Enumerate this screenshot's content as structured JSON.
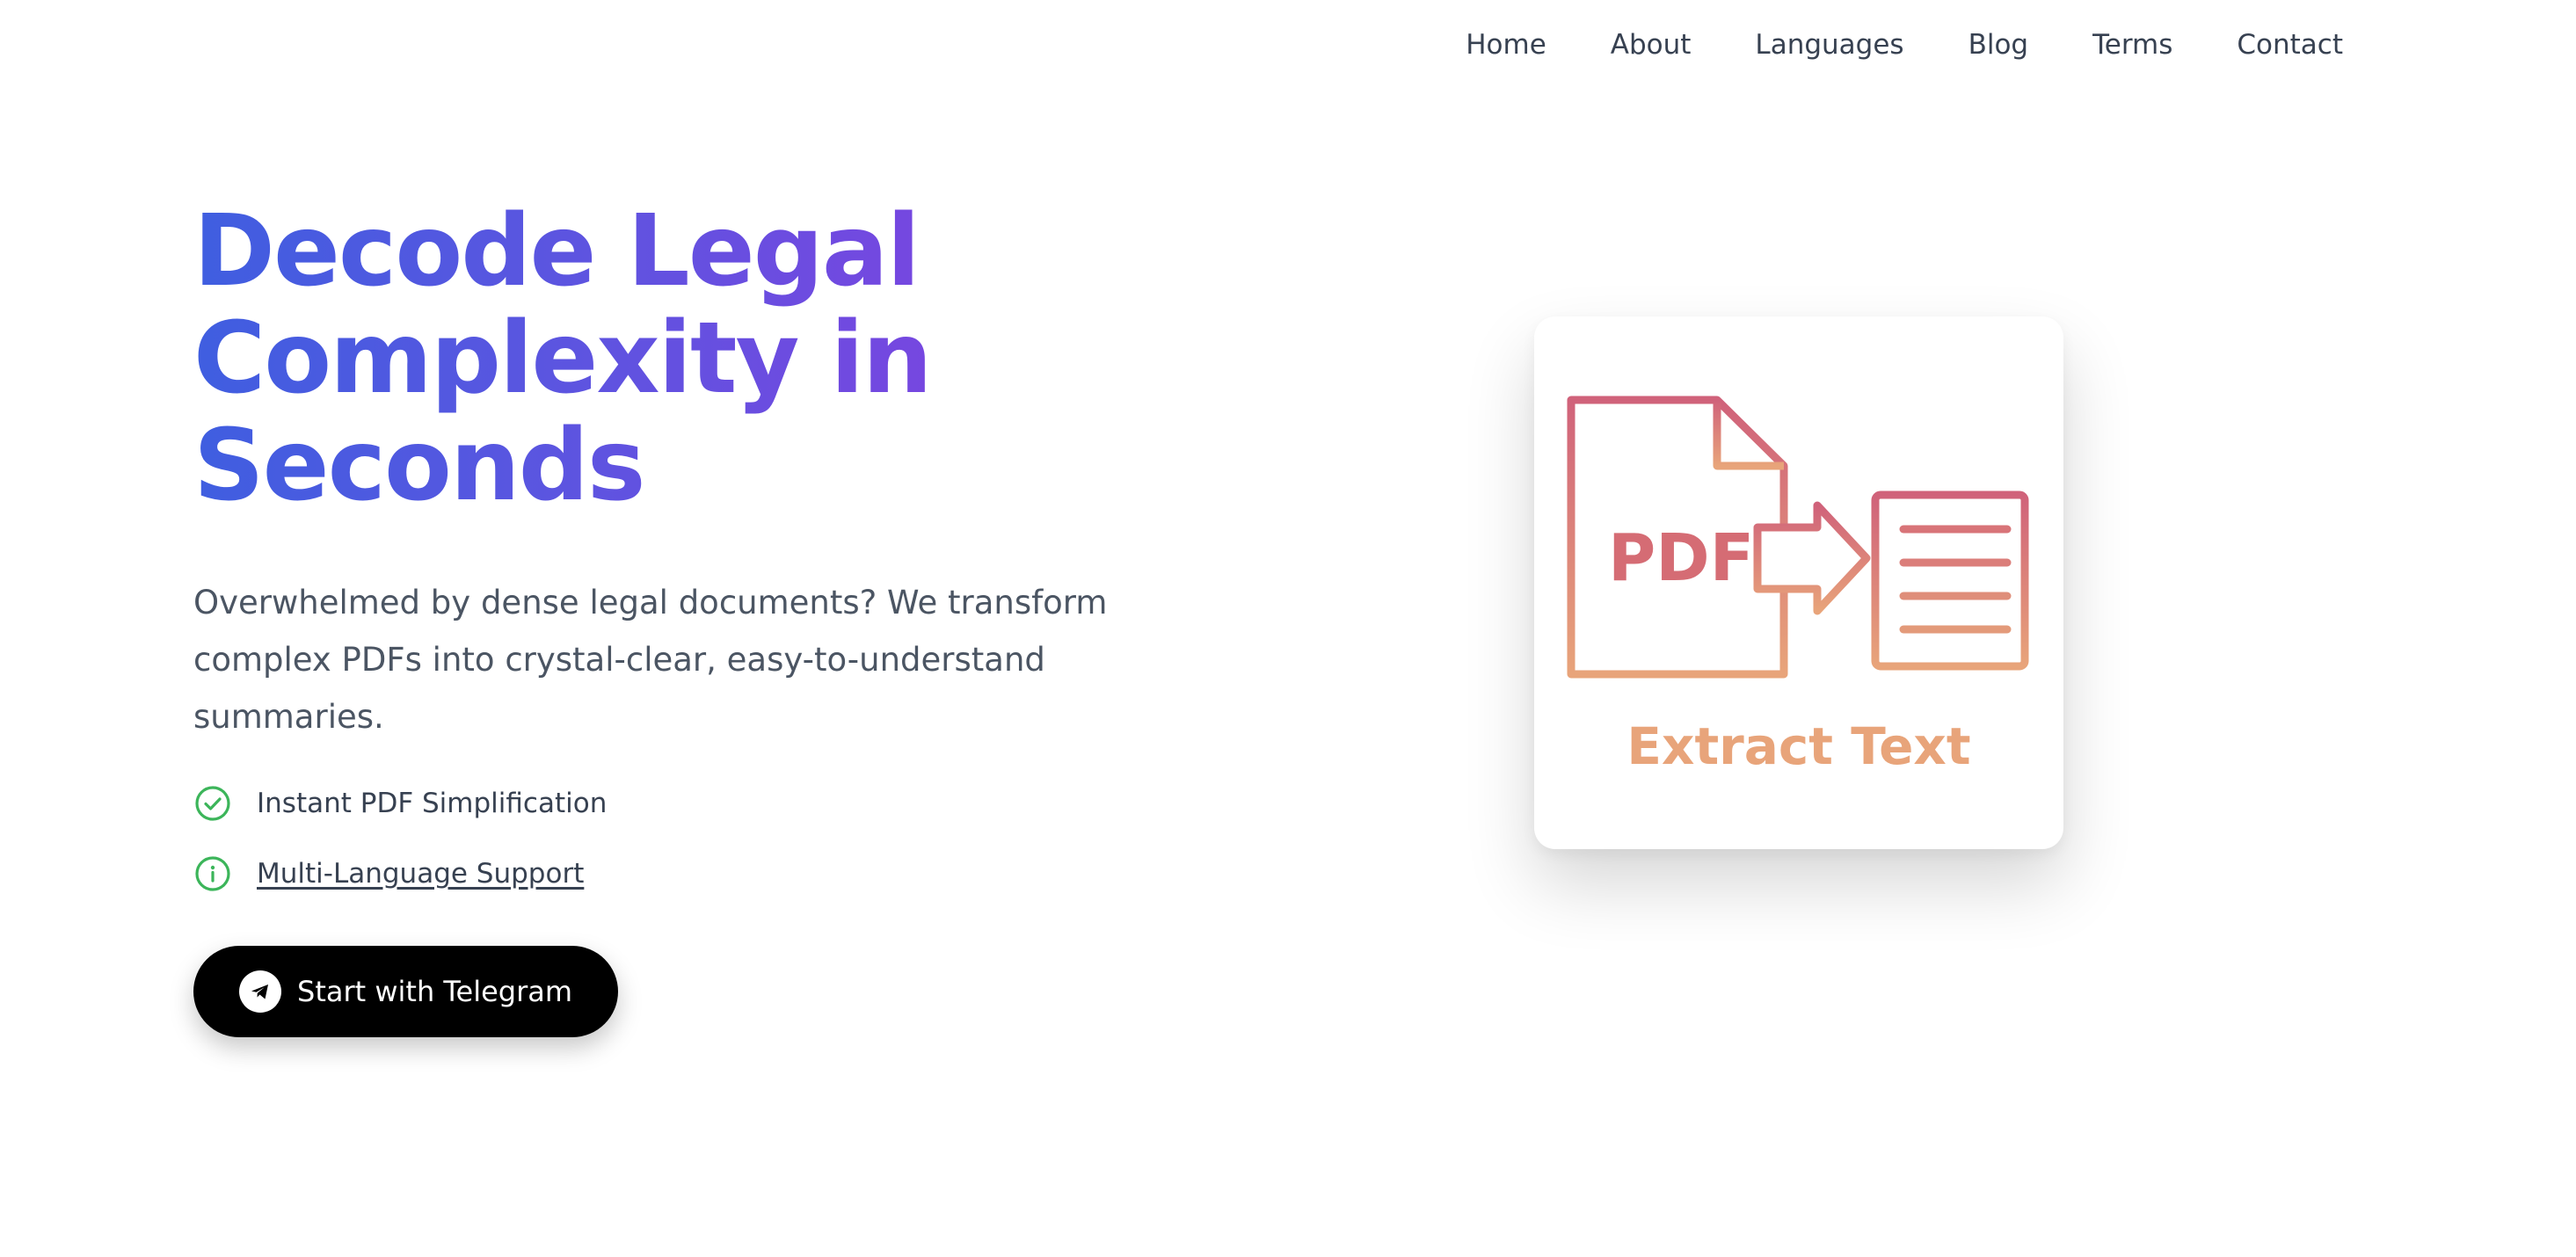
{
  "nav": {
    "items": [
      "Home",
      "About",
      "Languages",
      "Blog",
      "Terms",
      "Contact"
    ]
  },
  "hero": {
    "headline": "Decode Legal Complexity in Seconds",
    "subtitle": "Overwhelmed by dense legal documents? We transform complex PDFs into crystal-clear, easy-to-understand summaries.",
    "features": [
      {
        "label": "Instant PDF Simplification",
        "icon": "check-circle-icon"
      },
      {
        "label": "Multi-Language Support",
        "icon": "info-circle-icon"
      }
    ],
    "cta_label": "Start with Telegram"
  },
  "card": {
    "pdf_label": "PDF",
    "caption": "Extract Text"
  },
  "colors": {
    "headline_start": "#3f5ee0",
    "headline_end": "#7a45e0",
    "icon_green": "#3cb55a",
    "art_top": "#d0627a",
    "art_bottom": "#e8a47a"
  }
}
